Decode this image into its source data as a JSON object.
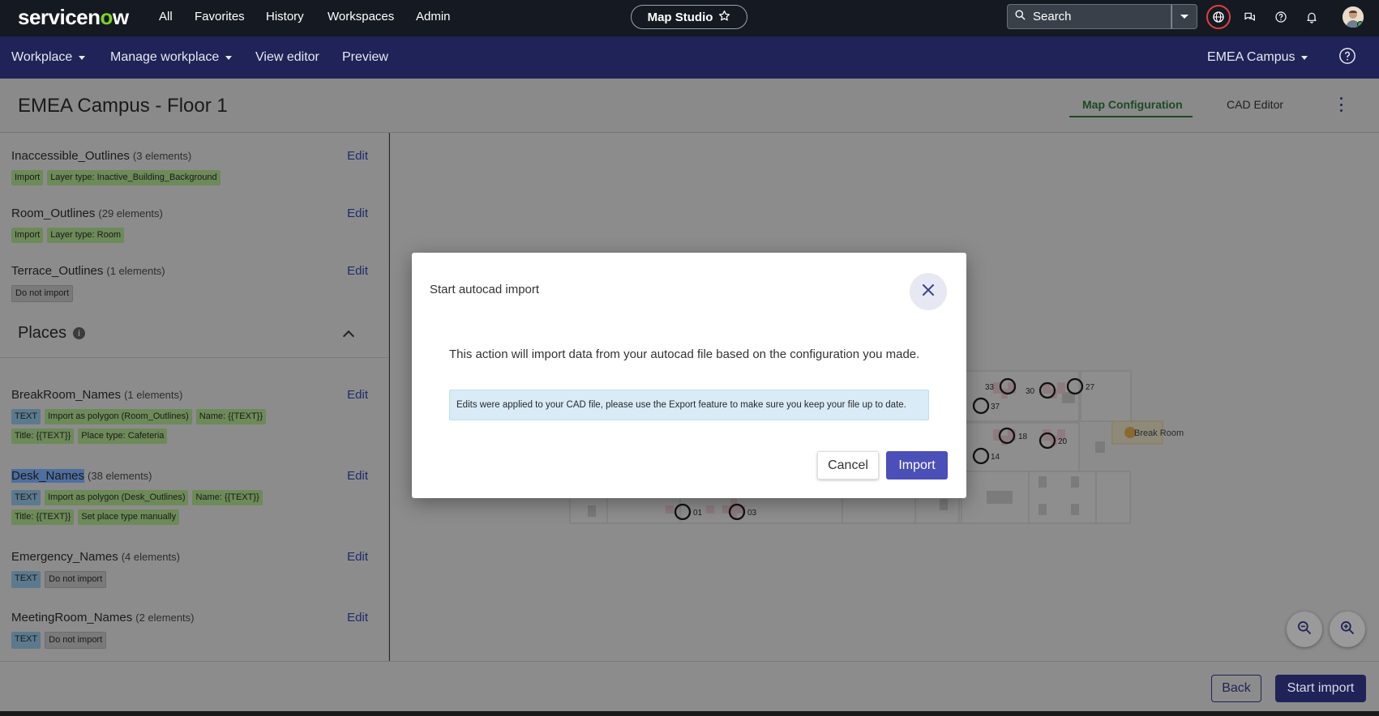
{
  "topbar": {
    "logo_text_a": "servicen",
    "logo_text_o": "o",
    "logo_text_b": "w",
    "nav": [
      "All",
      "Favorites",
      "History",
      "Workspaces",
      "Admin"
    ],
    "studio_label": "Map Studio",
    "search_placeholder": "Search"
  },
  "subbar": {
    "workplace": "Workplace",
    "manage": "Manage workplace",
    "view_editor": "View editor",
    "preview": "Preview",
    "campus": "EMEA Campus"
  },
  "page": {
    "title": "EMEA Campus - Floor 1",
    "tabs": [
      "Map Configuration",
      "CAD Editor"
    ]
  },
  "outlines": [
    {
      "name": "Inaccessible_Outlines",
      "count": "(3 elements)",
      "edit": "Edit",
      "chips": [
        {
          "text": "Import",
          "style": "green"
        },
        {
          "text": "Layer type: Inactive_Building_Background",
          "style": "green"
        }
      ]
    },
    {
      "name": "Room_Outlines",
      "count": "(29 elements)",
      "edit": "Edit",
      "chips": [
        {
          "text": "Import",
          "style": "green"
        },
        {
          "text": "Layer type: Room",
          "style": "green"
        }
      ]
    },
    {
      "name": "Terrace_Outlines",
      "count": "(1 elements)",
      "edit": "Edit",
      "chips": [
        {
          "text": "Do not import",
          "style": "gray"
        }
      ]
    }
  ],
  "places": {
    "title": "Places",
    "items": [
      {
        "name": "BreakRoom_Names",
        "count": "(1 elements)",
        "edit": "Edit",
        "chips": [
          {
            "text": "TEXT",
            "style": "blue"
          },
          {
            "text": "Import as polygon (Room_Outlines)",
            "style": "green"
          },
          {
            "text": "Name: {{TEXT}}",
            "style": "green"
          },
          {
            "text": "Title: {{TEXT}}",
            "style": "green"
          },
          {
            "text": "Place type: Cafeteria",
            "style": "green"
          }
        ]
      },
      {
        "name": "Desk_Names",
        "count": "(38 elements)",
        "edit": "Edit",
        "chips": [
          {
            "text": "TEXT",
            "style": "blue"
          },
          {
            "text": "Import as polygon (Desk_Outlines)",
            "style": "green"
          },
          {
            "text": "Name: {{TEXT}}",
            "style": "green"
          },
          {
            "text": "Title: {{TEXT}}",
            "style": "green"
          },
          {
            "text": "Set place type manually",
            "style": "green"
          }
        ]
      },
      {
        "name": "Emergency_Names",
        "count": "(4 elements)",
        "edit": "Edit",
        "chips": [
          {
            "text": "TEXT",
            "style": "blue"
          },
          {
            "text": "Do not import",
            "style": "gray"
          }
        ]
      },
      {
        "name": "MeetingRoom_Names",
        "count": "(2 elements)",
        "edit": "Edit",
        "chips": [
          {
            "text": "TEXT",
            "style": "blue"
          },
          {
            "text": "Do not import",
            "style": "gray"
          }
        ]
      }
    ]
  },
  "map": {
    "desk_labels": [
      "33",
      "30",
      "27",
      "37",
      "18",
      "20",
      "14",
      "01",
      "03"
    ],
    "break_room": "Break Room"
  },
  "footer": {
    "back": "Back",
    "start_import": "Start import"
  },
  "modal": {
    "title": "Start autocad import",
    "body": "This action will import data from your autocad file based on the configuration you made.",
    "note": "Edits were applied to your CAD file, please use the Export feature to make sure you keep your file up to date.",
    "cancel": "Cancel",
    "import": "Import"
  },
  "colors": {
    "topbar": "#151a22",
    "subbar": "#1f2357",
    "accent_green": "#7ed321",
    "import_button": "#4b4fb8"
  }
}
